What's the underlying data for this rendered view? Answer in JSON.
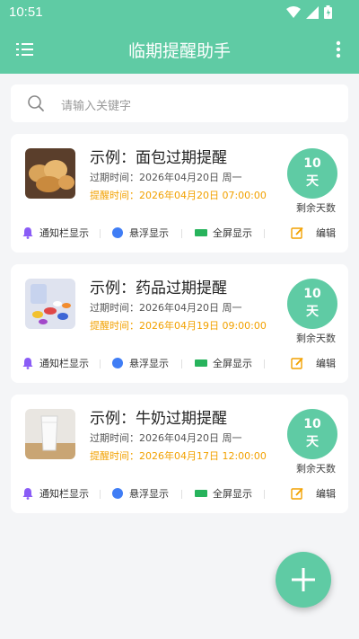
{
  "status_bar": {
    "time": "10:51"
  },
  "app_bar": {
    "title": "临期提醒助手"
  },
  "search": {
    "placeholder": "请输入关键字"
  },
  "labels": {
    "remaining_days": "剩余天数",
    "notify": "通知栏显示",
    "float": "悬浮显示",
    "fullscreen": "全屏显示",
    "edit": "编辑"
  },
  "cards": [
    {
      "title": "示例：面包过期提醒",
      "expire": "过期时间：2026年04月20日  周一",
      "remind": "提醒时间：2026年04月20日 07:00:00",
      "days": "10",
      "unit": "天",
      "image": "bread"
    },
    {
      "title": "示例：药品过期提醒",
      "expire": "过期时间：2026年04月20日  周一",
      "remind": "提醒时间：2026年04月19日 09:00:00",
      "days": "10",
      "unit": "天",
      "image": "medicine"
    },
    {
      "title": "示例：牛奶过期提醒",
      "expire": "过期时间：2026年04月20日  周一",
      "remind": "提醒时间：2026年04月17日 12:00:00",
      "days": "10",
      "unit": "天",
      "image": "milk"
    }
  ],
  "colors": {
    "primary": "#5fcba4",
    "remind": "#f2a100",
    "bell": "#8a5cf6",
    "float": "#3f7df5",
    "fullscreen": "#27b35c",
    "edit": "#f2a100"
  }
}
